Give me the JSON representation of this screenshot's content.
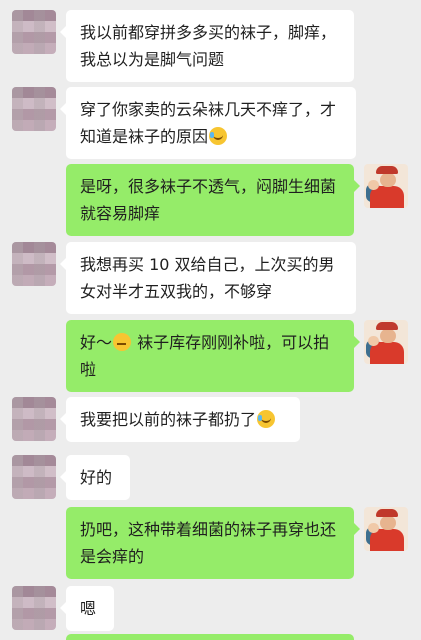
{
  "messages": [
    {
      "side": "in",
      "text": "我以前都穿拼多多买的袜子，脚痒，我总以为是脚气问题",
      "emoji": null
    },
    {
      "side": "in",
      "text": "穿了你家卖的云朵袜几天不痒了，才知道是袜子的原因",
      "emoji": "tears-of-joy-icon"
    },
    {
      "side": "out",
      "text": "是呀，很多袜子不透气，闷脚生细菌就容易脚痒",
      "emoji": null
    },
    {
      "side": "in",
      "text": "我想再买 10 双给自己，上次买的男女对半才五双我的，不够穿",
      "emoji": null
    },
    {
      "side": "out",
      "text_before": "好～",
      "text_after": " 袜子库存刚刚补啦，可以拍啦",
      "emoji": "thinking-face-icon"
    },
    {
      "side": "in",
      "text": "我要把以前的袜子都扔了",
      "emoji": "tears-of-joy-icon"
    },
    {
      "side": "in",
      "text": "好的",
      "emoji": null
    },
    {
      "side": "out",
      "text": "扔吧，这种带着细菌的袜子再穿也还是会痒的",
      "emoji": null
    },
    {
      "side": "in",
      "text": "嗯",
      "emoji": null
    }
  ],
  "colors": {
    "background": "#ededed",
    "incoming_bubble": "#ffffff",
    "outgoing_bubble": "#95ec69"
  }
}
